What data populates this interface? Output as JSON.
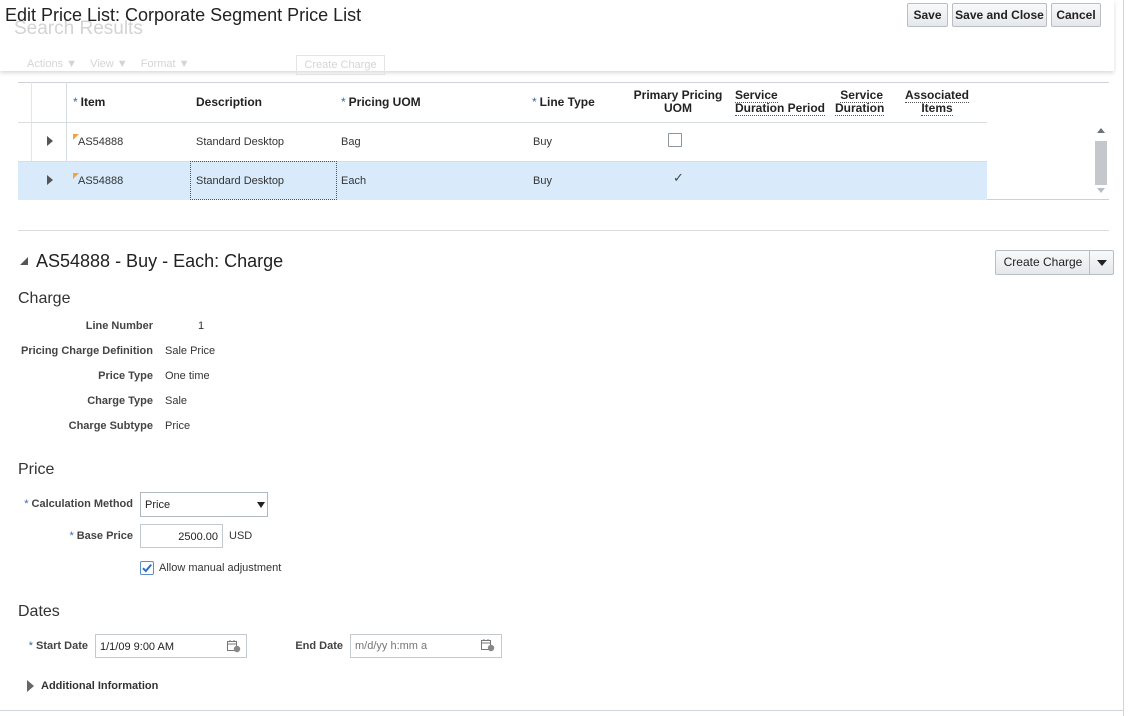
{
  "window": {
    "title": "Edit Price List: Corporate Segment Price List",
    "underlay_title": "Search Results",
    "underlay_toolbar": [
      "Actions ▼",
      "View ▼",
      "Format ▼"
    ],
    "underlay_button": "Create Charge"
  },
  "toolbar": {
    "save_label": "Save",
    "save_close_label": "Save and Close",
    "cancel_label": "Cancel"
  },
  "table": {
    "columns": {
      "item": "Item",
      "description": "Description",
      "pricing_uom": "Pricing UOM",
      "line_type": "Line Type",
      "primary_1": "Primary Pricing",
      "primary_2": "UOM",
      "sdp_1": "Service",
      "sdp_2": "Duration Period",
      "sd_1": "Service",
      "sd_2": "Duration",
      "ai_1": "Associated",
      "ai_2": "Items"
    },
    "required_marker": "*",
    "rows": [
      {
        "item": "AS54888",
        "description": "Standard Desktop",
        "pricing_uom": "Bag",
        "line_type": "Buy",
        "primary": false
      },
      {
        "item": "AS54888",
        "description": "Standard Desktop",
        "pricing_uom": "Each",
        "line_type": "Buy",
        "primary": true
      }
    ],
    "check_glyph": "✓"
  },
  "detail": {
    "title": "AS54888 - Buy - Each: Charge",
    "create_charge_label": "Create Charge",
    "charge": {
      "heading": "Charge",
      "line_number_label": "Line Number",
      "line_number": "1",
      "pcd_label": "Pricing Charge Definition",
      "pcd": "Sale Price",
      "price_type_label": "Price Type",
      "price_type": "One time",
      "charge_type_label": "Charge Type",
      "charge_type": "Sale",
      "charge_subtype_label": "Charge Subtype",
      "charge_subtype": "Price"
    },
    "price": {
      "heading": "Price",
      "calc_method_label": "Calculation Method",
      "calc_method_value": "Price",
      "base_price_label": "Base Price",
      "base_price_value": "2500.00",
      "currency": "USD",
      "allow_manual_label": "Allow manual adjustment",
      "allow_manual_checked": true
    },
    "dates": {
      "heading": "Dates",
      "start_label": "Start Date",
      "start_value": "1/1/09 9:00 AM",
      "end_label": "End Date",
      "end_placeholder": "m/d/yy h:mm a"
    },
    "additional_info_label": "Additional Information"
  },
  "colors": {
    "accent": "#326bb0",
    "selected_row": "#d9ebfb",
    "flag": "#f5a046"
  }
}
